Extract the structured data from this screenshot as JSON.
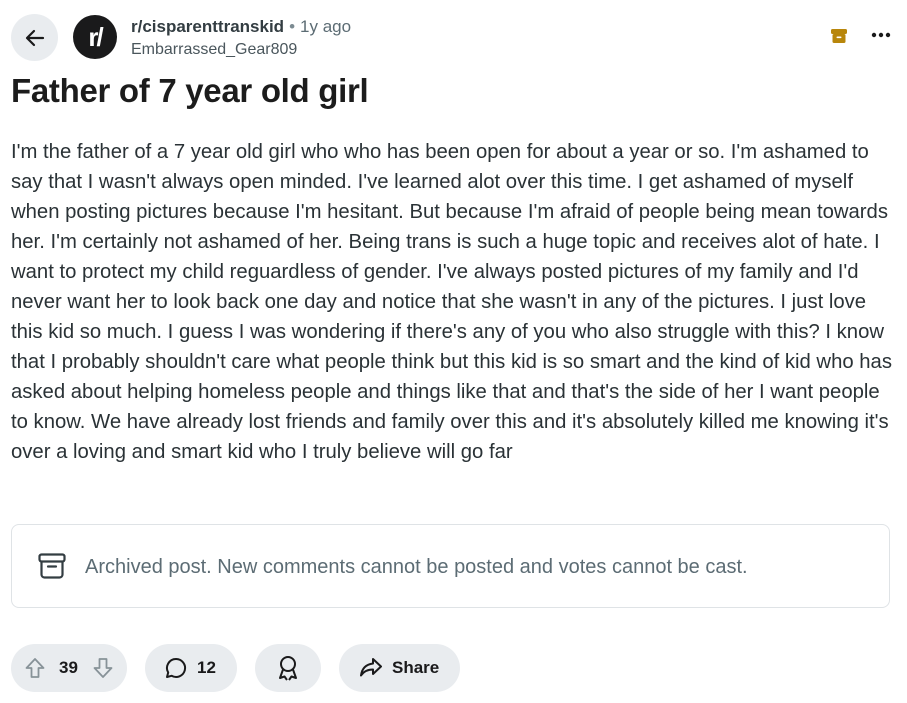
{
  "post": {
    "subreddit": "r/cisparenttranskid",
    "subreddit_avatar_text": "r/",
    "separator": "•",
    "time": "1y ago",
    "author": "Embarrassed_Gear809",
    "title": "Father of 7 year old girl",
    "body": "I'm the father of a 7 year old girl who who has been open for about a year or so. I'm ashamed to say that I wasn't always open minded. I've learned alot over this time. I get ashamed of myself when posting pictures because I'm hesitant. But because I'm afraid of people being mean towards her. I'm certainly not ashamed of her. Being trans is such a huge topic and receives alot of hate. I want to protect my child reguardless of gender. I've always posted pictures of my family and I'd never want her to look back one day and notice that she wasn't in any of the pictures. I just love this kid so much. I guess I was wondering if there's any of you who also struggle with this? I know that I probably shouldn't care what people think but this kid is so smart and the kind of kid who has asked about helping homeless people and things like that and that's the side of her I want people to know. We have already lost friends and family over this and it's absolutely killed me knowing it's over a loving and smart kid who I truly believe will go far"
  },
  "archived_notice": "Archived post. New comments cannot be posted and votes cannot be cast.",
  "actions": {
    "votes": "39",
    "comments": "12",
    "share_label": "Share"
  },
  "icons": {
    "back": "arrow-left-icon",
    "archive": "archive-icon",
    "more": "ellipsis-icon",
    "upvote": "upvote-arrow-icon",
    "downvote": "downvote-arrow-icon",
    "comment": "comment-bubble-icon",
    "award": "award-icon",
    "share": "share-arrow-icon"
  },
  "colors": {
    "archive_accent": "#b8860b",
    "pill_bg": "#e9ecef"
  }
}
